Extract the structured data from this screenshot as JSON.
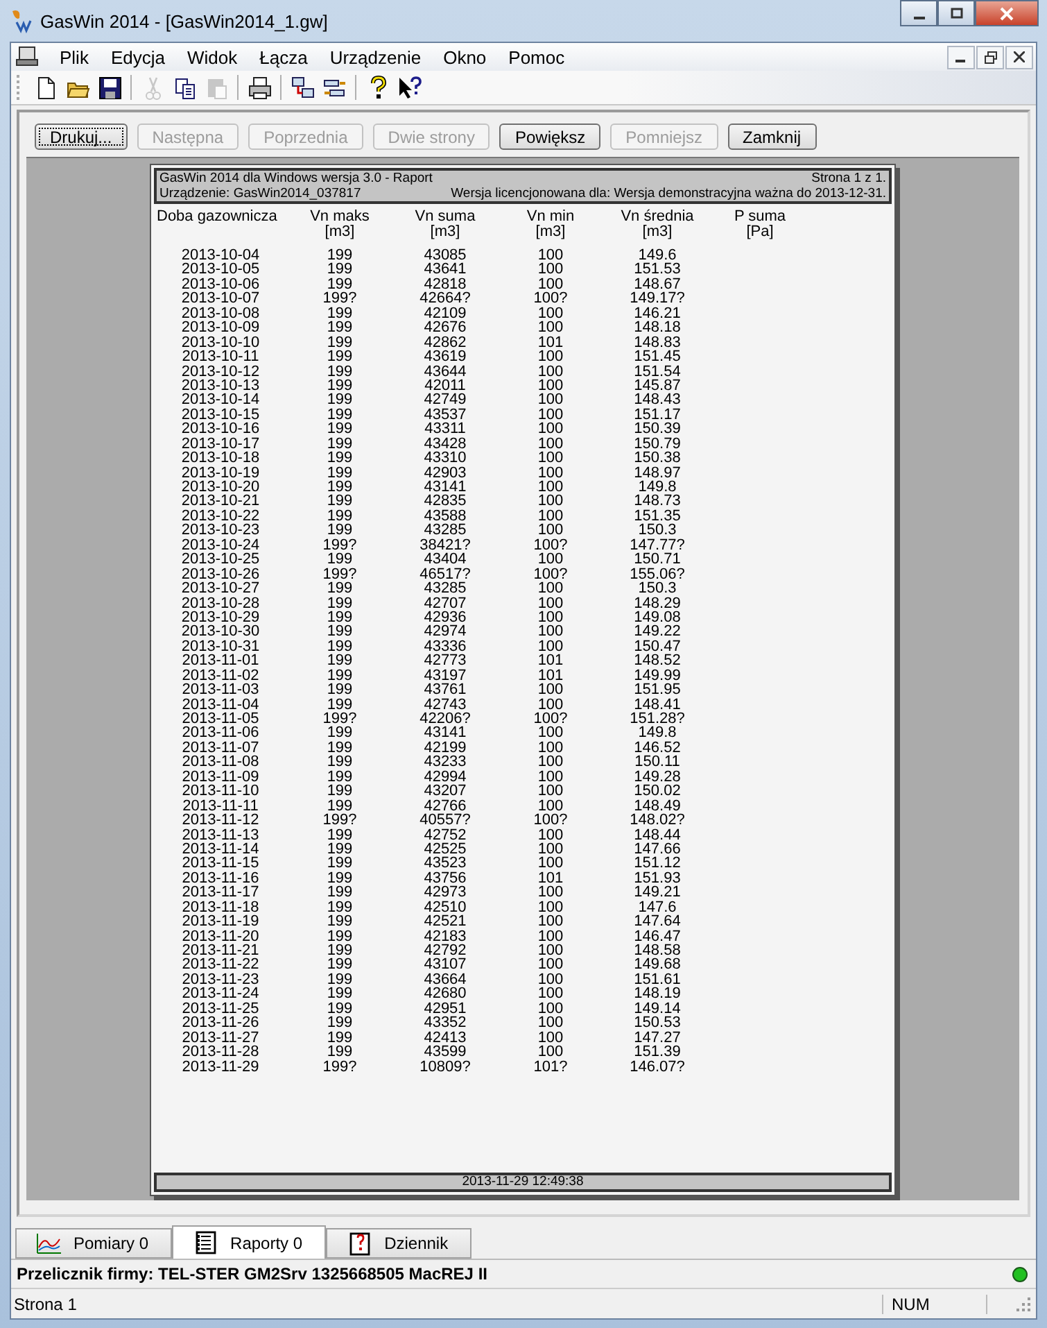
{
  "window": {
    "title": "GasWin 2014 - [GasWin2014_1.gw]"
  },
  "menu": [
    {
      "label": "Plik"
    },
    {
      "label": "Edycja"
    },
    {
      "label": "Widok"
    },
    {
      "label": "Łącza"
    },
    {
      "label": "Urządzenie"
    },
    {
      "label": "Okno"
    },
    {
      "label": "Pomoc"
    }
  ],
  "toolbar": [
    {
      "kind": "new",
      "disabled": false
    },
    {
      "kind": "open",
      "disabled": false
    },
    {
      "kind": "save",
      "disabled": false
    },
    {
      "kind": "sep"
    },
    {
      "kind": "cut",
      "disabled": true
    },
    {
      "kind": "copy",
      "disabled": false
    },
    {
      "kind": "paste",
      "disabled": true
    },
    {
      "kind": "sep"
    },
    {
      "kind": "print",
      "disabled": false
    },
    {
      "kind": "sep"
    },
    {
      "kind": "device",
      "disabled": false
    },
    {
      "kind": "link",
      "disabled": false
    },
    {
      "kind": "sep"
    },
    {
      "kind": "help",
      "disabled": false
    },
    {
      "kind": "whatsthis",
      "disabled": false
    }
  ],
  "preview_buttons": [
    {
      "label": "Drukuj...",
      "disabled": false,
      "focused": true
    },
    {
      "label": "Następna",
      "disabled": true,
      "focused": false
    },
    {
      "label": "Poprzednia",
      "disabled": true,
      "focused": false
    },
    {
      "label": "Dwie strony",
      "disabled": true,
      "focused": false
    },
    {
      "label": "Powiększ",
      "disabled": false,
      "focused": false
    },
    {
      "label": "Pomniejsz",
      "disabled": true,
      "focused": false
    },
    {
      "label": "Zamknij",
      "disabled": false,
      "focused": false
    }
  ],
  "report": {
    "title": "GasWin 2014 dla Windows wersja 3.0  - Raport",
    "page": "Strona 1 z 1.",
    "device": "Urządzenie: GasWin2014_037817",
    "license": "Wersja licencjonowana dla: Wersja demonstracyjna ważna do 2013-12-31.",
    "columns": [
      {
        "name": "Doba gazownicza"
      },
      {
        "name": "Vn maks",
        "unit": "[m3]"
      },
      {
        "name": "Vn suma",
        "unit": "[m3]"
      },
      {
        "name": "Vn min",
        "unit": "[m3]"
      },
      {
        "name": "Vn średnia",
        "unit": "[m3]"
      },
      {
        "name": "P suma",
        "unit": "[Pa]"
      }
    ],
    "rows": [
      [
        "2013-10-04",
        "199",
        "43085",
        "100",
        "149.6"
      ],
      [
        "2013-10-05",
        "199",
        "43641",
        "100",
        "151.53"
      ],
      [
        "2013-10-06",
        "199",
        "42818",
        "100",
        "148.67"
      ],
      [
        "2013-10-07",
        "199?",
        "42664?",
        "100?",
        "149.17?"
      ],
      [
        "2013-10-08",
        "199",
        "42109",
        "100",
        "146.21"
      ],
      [
        "2013-10-09",
        "199",
        "42676",
        "100",
        "148.18"
      ],
      [
        "2013-10-10",
        "199",
        "42862",
        "101",
        "148.83"
      ],
      [
        "2013-10-11",
        "199",
        "43619",
        "100",
        "151.45"
      ],
      [
        "2013-10-12",
        "199",
        "43644",
        "100",
        "151.54"
      ],
      [
        "2013-10-13",
        "199",
        "42011",
        "100",
        "145.87"
      ],
      [
        "2013-10-14",
        "199",
        "42749",
        "100",
        "148.43"
      ],
      [
        "2013-10-15",
        "199",
        "43537",
        "100",
        "151.17"
      ],
      [
        "2013-10-16",
        "199",
        "43311",
        "100",
        "150.39"
      ],
      [
        "2013-10-17",
        "199",
        "43428",
        "100",
        "150.79"
      ],
      [
        "2013-10-18",
        "199",
        "43310",
        "100",
        "150.38"
      ],
      [
        "2013-10-19",
        "199",
        "42903",
        "100",
        "148.97"
      ],
      [
        "2013-10-20",
        "199",
        "43141",
        "100",
        "149.8"
      ],
      [
        "2013-10-21",
        "199",
        "42835",
        "100",
        "148.73"
      ],
      [
        "2013-10-22",
        "199",
        "43588",
        "100",
        "151.35"
      ],
      [
        "2013-10-23",
        "199",
        "43285",
        "100",
        "150.3"
      ],
      [
        "2013-10-24",
        "199?",
        "38421?",
        "100?",
        "147.77?"
      ],
      [
        "2013-10-25",
        "199",
        "43404",
        "100",
        "150.71"
      ],
      [
        "2013-10-26",
        "199?",
        "46517?",
        "100?",
        "155.06?"
      ],
      [
        "2013-10-27",
        "199",
        "43285",
        "100",
        "150.3"
      ],
      [
        "2013-10-28",
        "199",
        "42707",
        "100",
        "148.29"
      ],
      [
        "2013-10-29",
        "199",
        "42936",
        "100",
        "149.08"
      ],
      [
        "2013-10-30",
        "199",
        "42974",
        "100",
        "149.22"
      ],
      [
        "2013-10-31",
        "199",
        "43336",
        "100",
        "150.47"
      ],
      [
        "2013-11-01",
        "199",
        "42773",
        "101",
        "148.52"
      ],
      [
        "2013-11-02",
        "199",
        "43197",
        "101",
        "149.99"
      ],
      [
        "2013-11-03",
        "199",
        "43761",
        "100",
        "151.95"
      ],
      [
        "2013-11-04",
        "199",
        "42743",
        "100",
        "148.41"
      ],
      [
        "2013-11-05",
        "199?",
        "42206?",
        "100?",
        "151.28?"
      ],
      [
        "2013-11-06",
        "199",
        "43141",
        "100",
        "149.8"
      ],
      [
        "2013-11-07",
        "199",
        "42199",
        "100",
        "146.52"
      ],
      [
        "2013-11-08",
        "199",
        "43233",
        "100",
        "150.11"
      ],
      [
        "2013-11-09",
        "199",
        "42994",
        "100",
        "149.28"
      ],
      [
        "2013-11-10",
        "199",
        "43207",
        "100",
        "150.02"
      ],
      [
        "2013-11-11",
        "199",
        "42766",
        "100",
        "148.49"
      ],
      [
        "2013-11-12",
        "199?",
        "40557?",
        "100?",
        "148.02?"
      ],
      [
        "2013-11-13",
        "199",
        "42752",
        "100",
        "148.44"
      ],
      [
        "2013-11-14",
        "199",
        "42525",
        "100",
        "147.66"
      ],
      [
        "2013-11-15",
        "199",
        "43523",
        "100",
        "151.12"
      ],
      [
        "2013-11-16",
        "199",
        "43756",
        "101",
        "151.93"
      ],
      [
        "2013-11-17",
        "199",
        "42973",
        "100",
        "149.21"
      ],
      [
        "2013-11-18",
        "199",
        "42510",
        "100",
        "147.6"
      ],
      [
        "2013-11-19",
        "199",
        "42521",
        "100",
        "147.64"
      ],
      [
        "2013-11-20",
        "199",
        "42183",
        "100",
        "146.47"
      ],
      [
        "2013-11-21",
        "199",
        "42792",
        "100",
        "148.58"
      ],
      [
        "2013-11-22",
        "199",
        "43107",
        "100",
        "149.68"
      ],
      [
        "2013-11-23",
        "199",
        "43664",
        "100",
        "151.61"
      ],
      [
        "2013-11-24",
        "199",
        "42680",
        "100",
        "148.19"
      ],
      [
        "2013-11-25",
        "199",
        "42951",
        "100",
        "149.14"
      ],
      [
        "2013-11-26",
        "199",
        "43352",
        "100",
        "150.53"
      ],
      [
        "2013-11-27",
        "199",
        "42413",
        "100",
        "147.27"
      ],
      [
        "2013-11-28",
        "199",
        "43599",
        "100",
        "151.39"
      ],
      [
        "2013-11-29",
        "199?",
        "10809?",
        "101?",
        "146.07?"
      ]
    ],
    "footer": "2013-11-29 12:49:38"
  },
  "tabs": [
    {
      "label": "Pomiary 0",
      "kind": "measurements",
      "selected": false
    },
    {
      "label": "Raporty 0",
      "kind": "reports",
      "selected": true
    },
    {
      "label": "Dziennik",
      "kind": "log",
      "selected": false
    }
  ],
  "firm_bar": {
    "text": "Przelicznik firmy: TEL-STER GM2Srv 1325668505 MacREJ II",
    "connected": true
  },
  "status_bar": {
    "text": "Strona 1",
    "indicator": "NUM"
  }
}
